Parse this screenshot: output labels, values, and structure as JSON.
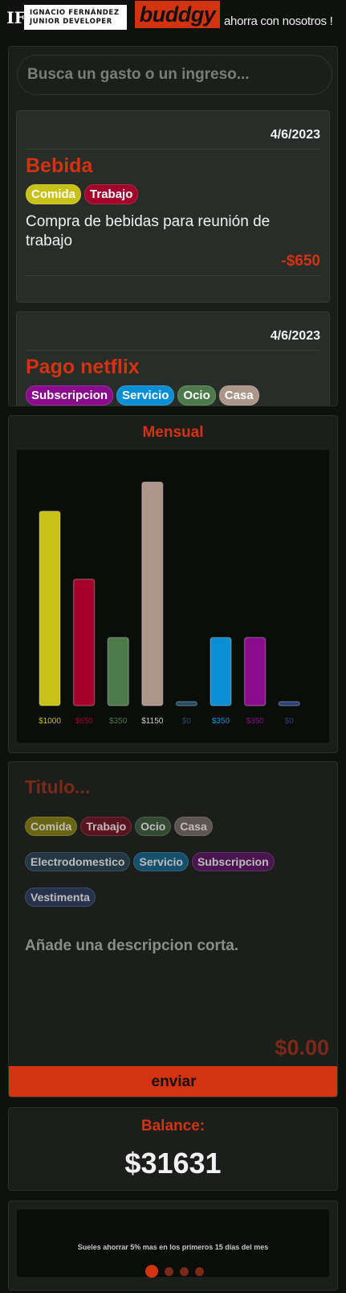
{
  "header": {
    "logo_mark": "IF",
    "logo_line1": "IGNACIO FERNÁNDEZ",
    "logo_line2": "JUNIOR DEVELOPER",
    "brand": "buddgy",
    "tagline": "ahorra con nosotros !"
  },
  "search": {
    "placeholder": "Busca un gasto o un ingreso..."
  },
  "entries": [
    {
      "date": "4/6/2023",
      "title": "Bebida",
      "tags": [
        {
          "label": "Comida",
          "color": "#c8c117"
        },
        {
          "label": "Trabajo",
          "color": "#a3002a"
        }
      ],
      "description": "Compra de bebidas para reunión de trabajo",
      "amount": "-$650"
    },
    {
      "date": "4/6/2023",
      "title": "Pago netflix",
      "tags": [
        {
          "label": "Subscripcion",
          "color": "#8a0b8c"
        },
        {
          "label": "Servicio",
          "color": "#0a8fd4"
        },
        {
          "label": "Ocio",
          "color": "#4c7a4a"
        },
        {
          "label": "Casa",
          "color": "#ae958a"
        }
      ]
    }
  ],
  "chart_data": {
    "type": "bar",
    "title": "Mensual",
    "categories": [
      "Comida",
      "Trabajo",
      "Ocio",
      "Casa",
      "Electrodomestico",
      "Servicio",
      "Subscripcion",
      "Vestimenta"
    ],
    "values": [
      1000,
      650,
      350,
      1150,
      0,
      350,
      350,
      0
    ],
    "value_labels": [
      "$1000",
      "$650",
      "$350",
      "$1150",
      "$0",
      "$350",
      "$350",
      "$0"
    ],
    "colors": [
      "#c8c117",
      "#a3002a",
      "#4c7a4a",
      "#ae958a",
      "#1f4a66",
      "#0a8fd4",
      "#8a0b8c",
      "#2a3f7a"
    ],
    "ylim": [
      0,
      1200
    ],
    "grid": false
  },
  "form": {
    "title_placeholder": "Titulo...",
    "tag_rows": [
      [
        {
          "label": "Comida",
          "color": "#6a6512"
        },
        {
          "label": "Trabajo",
          "color": "#5a1420"
        },
        {
          "label": "Ocio",
          "color": "#344a33"
        },
        {
          "label": "Casa",
          "color": "#5e5450"
        }
      ],
      [
        {
          "label": "Electrodomestico",
          "color": "#243744"
        },
        {
          "label": "Servicio",
          "color": "#15506d"
        },
        {
          "label": "Subscripcion",
          "color": "#4a1550"
        }
      ],
      [
        {
          "label": "Vestimenta",
          "color": "#27324e"
        }
      ]
    ],
    "description_placeholder": "Añade una descripcion corta.",
    "amount": "$0.00",
    "submit_label": "enviar"
  },
  "balance": {
    "label": "Balance:",
    "value": "$31631"
  },
  "tips": {
    "text": "Sueles ahorrar 5% mas en los primeros 15 días del mes",
    "dots": 4,
    "active": 0
  }
}
